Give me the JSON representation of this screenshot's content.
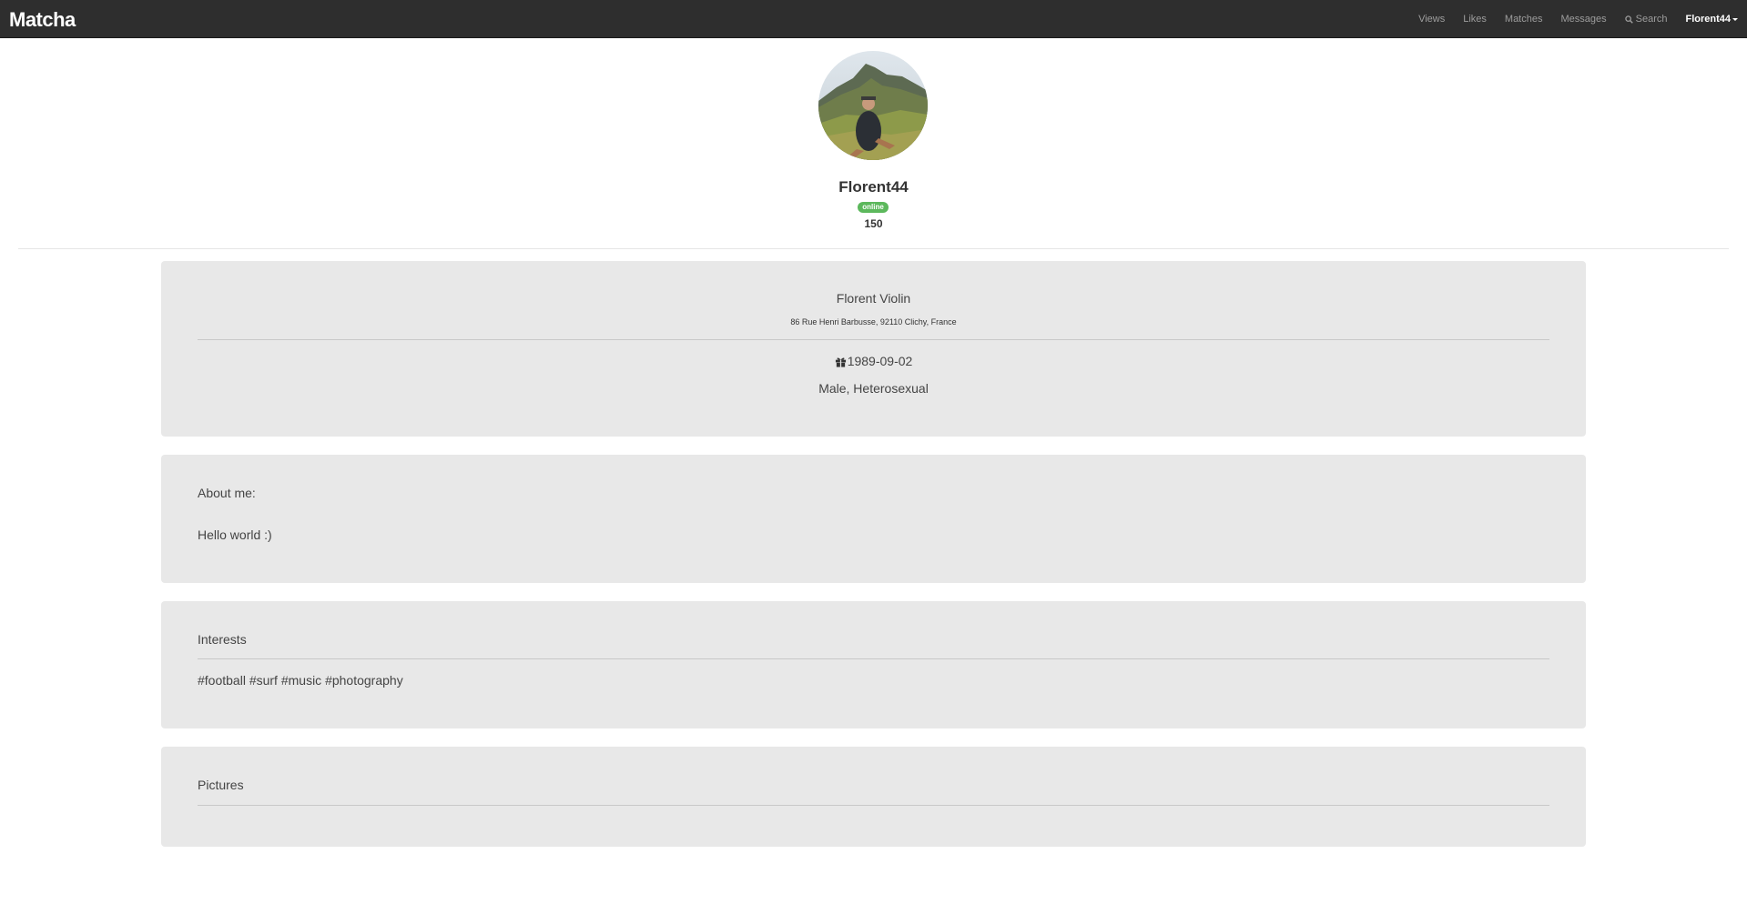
{
  "navbar": {
    "brand": "Matcha",
    "links": {
      "views": "Views",
      "likes": "Likes",
      "matches": "Matches",
      "messages": "Messages",
      "search": "Search"
    },
    "user": "Florent44"
  },
  "profile": {
    "username": "Florent44",
    "status": "online",
    "score": "150"
  },
  "info": {
    "full_name": "Florent Violin",
    "address": "86 Rue Henri Barbusse, 92110 Clichy, France",
    "birthdate": "1989-09-02",
    "gender_orientation": "Male, Heterosexual"
  },
  "about": {
    "title": "About me:",
    "text": "Hello world :)"
  },
  "interests": {
    "title": "Interests",
    "tags": "#football #surf #music #photography"
  },
  "pictures": {
    "title": "Pictures"
  },
  "colors": {
    "navbar_bg": "#2e2e2e",
    "online_badge": "#5cb85c",
    "card_bg": "#e8e8e8"
  }
}
